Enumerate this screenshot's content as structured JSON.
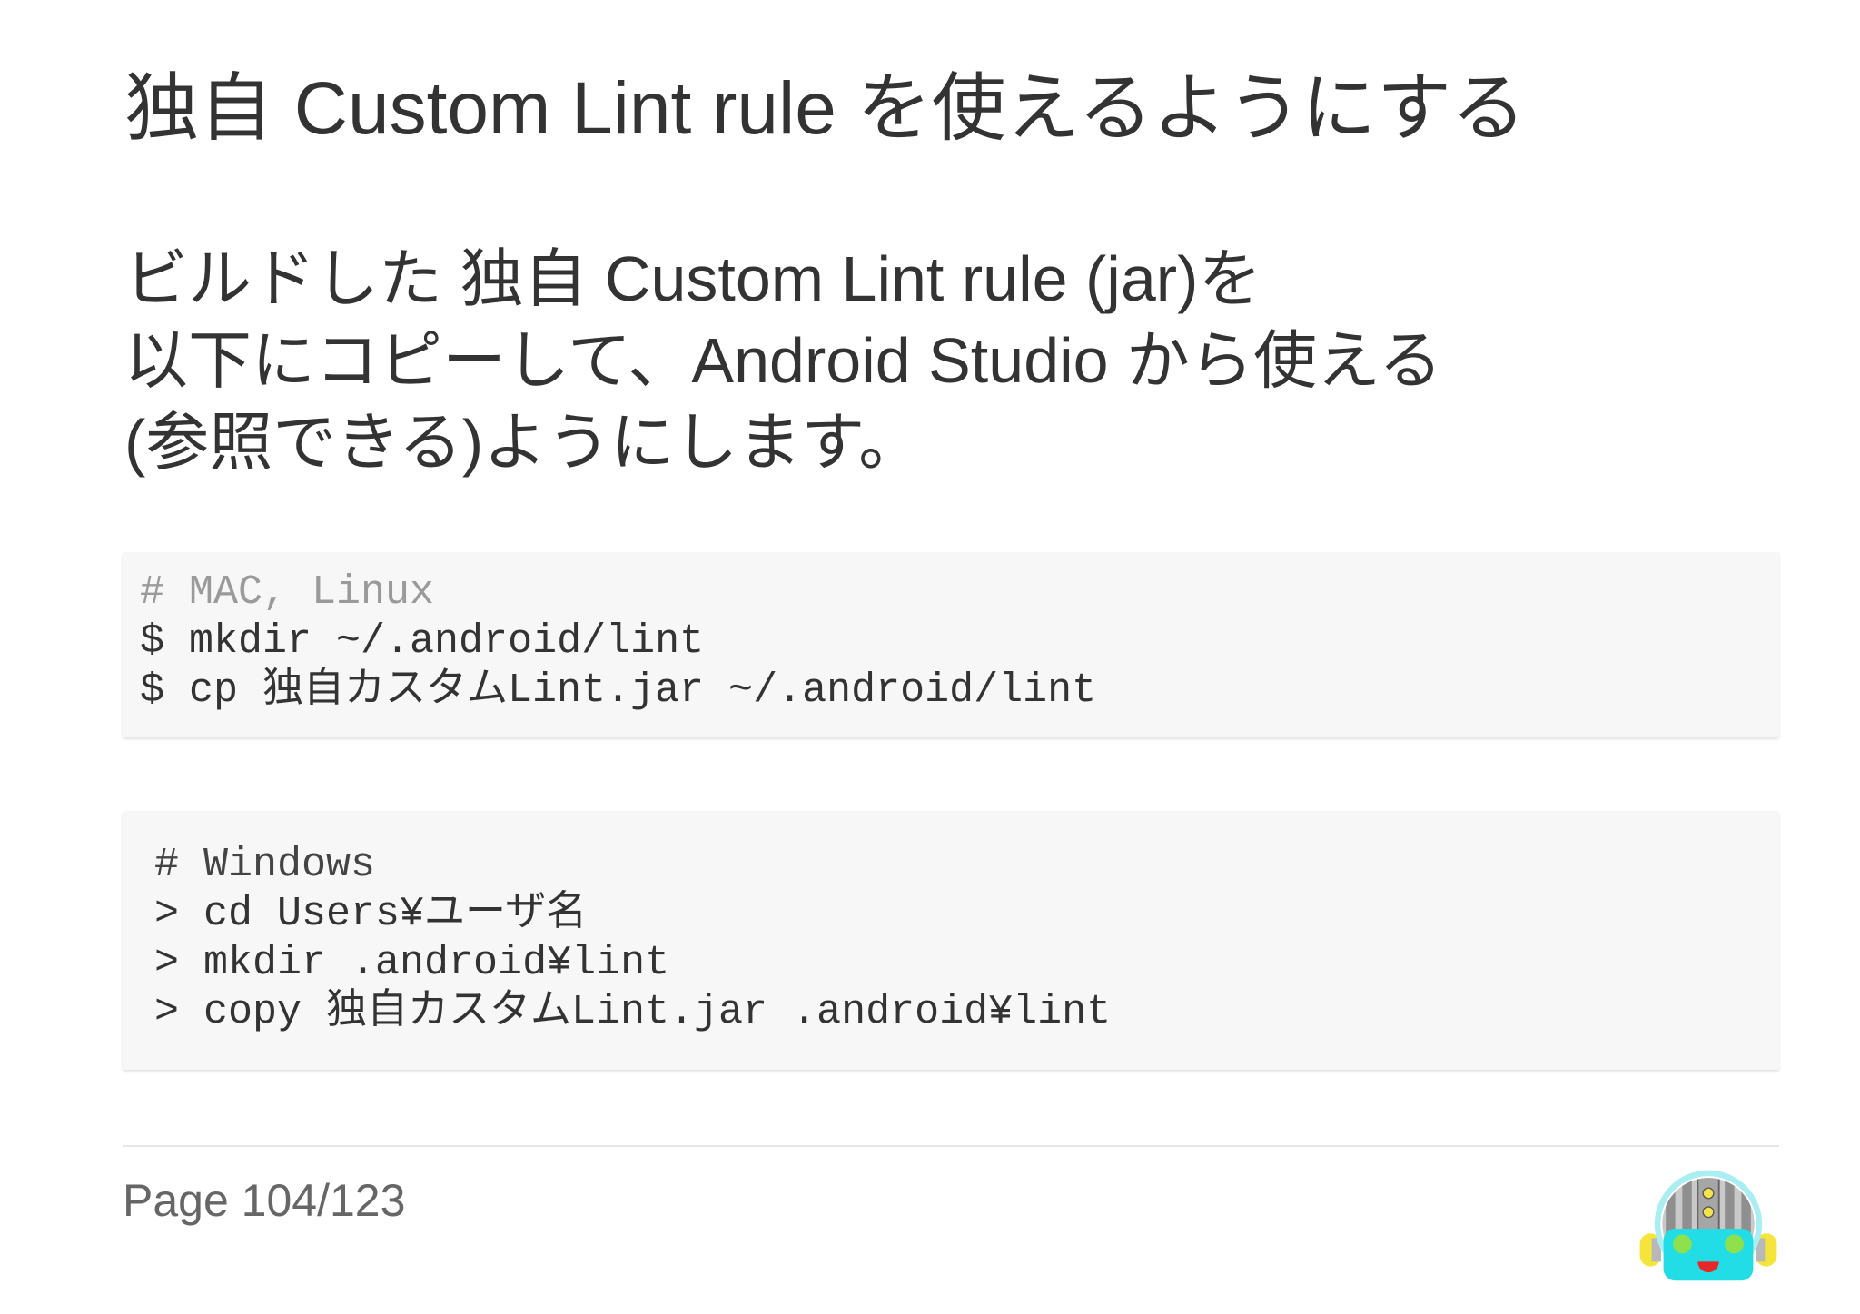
{
  "slide": {
    "title": "独自 Custom Lint rule を使えるようにする",
    "body_lines": [
      "ビルドした 独自 Custom Lint rule (jar)を",
      "以下にコピーして、Android Studio から使える",
      "(参照できる)ようにします。"
    ],
    "code_blocks": [
      {
        "lines": [
          {
            "text": "# MAC, Linux",
            "color": "#9a9a9a"
          },
          {
            "text": "$ mkdir ~/.android/lint",
            "color": "#333333"
          },
          {
            "text": "$ cp 独自カスタムLint.jar ~/.android/lint",
            "color": "#333333"
          }
        ]
      },
      {
        "lines": [
          {
            "text": "# Windows",
            "color": "#444444"
          },
          {
            "text": "> cd Users¥ユーザ名",
            "color": "#333333"
          },
          {
            "text": "> mkdir .android¥lint",
            "color": "#333333"
          },
          {
            "text": "> copy 独自カスタムLint.jar .android¥lint",
            "color": "#333333"
          }
        ]
      }
    ]
  },
  "footer": {
    "page_label": "Page 104/123"
  },
  "logo": {
    "icon": "robot-mascot-icon",
    "colors": {
      "face": "#22dde6",
      "eyes": "#8ee04c",
      "mouth": "#e62828",
      "ears": "#f5e53a",
      "dome_outline": "#a8eef2"
    }
  }
}
